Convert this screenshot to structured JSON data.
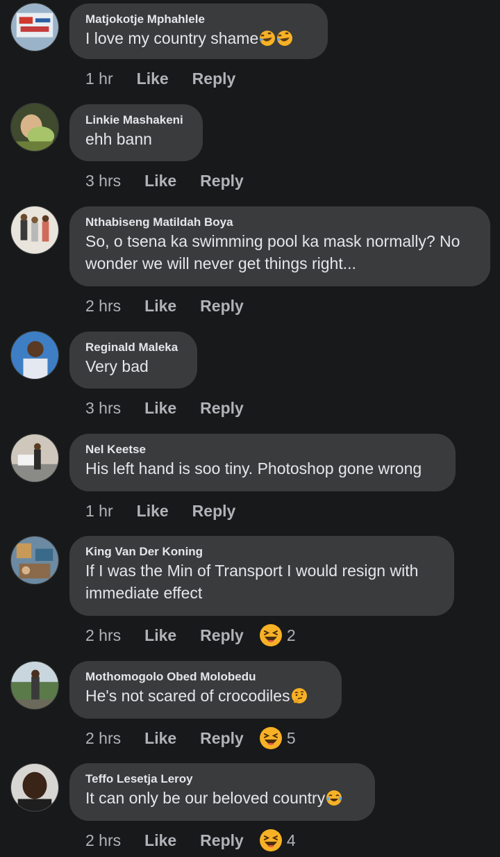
{
  "comments": [
    {
      "author": "Matjokotje Mphahlele",
      "text": "I love my country shame",
      "time": "1 hr",
      "like": "Like",
      "reply": "Reply",
      "inline_emojis": [
        "rolling-laughing-emoji",
        "rolling-laughing-emoji"
      ]
    },
    {
      "author": "Linkie Mashakeni",
      "text": "ehh bann",
      "time": "3 hrs",
      "like": "Like",
      "reply": "Reply"
    },
    {
      "author": "Nthabiseng Matildah Boya",
      "text": "So, o tsena ka swimming pool ka mask normally? No wonder we will never get things right...",
      "time": "2 hrs",
      "like": "Like",
      "reply": "Reply"
    },
    {
      "author": "Reginald Maleka",
      "text": "Very bad",
      "time": "3 hrs",
      "like": "Like",
      "reply": "Reply"
    },
    {
      "author": "Nel Keetse",
      "text": "His left hand is soo tiny. Photoshop gone wrong",
      "time": "1 hr",
      "like": "Like",
      "reply": "Reply"
    },
    {
      "author": "King Van Der Koning",
      "text": "If I was the Min of Transport I would resign with immediate effect",
      "time": "2 hrs",
      "like": "Like",
      "reply": "Reply",
      "reaction": {
        "icon": "haha-reaction-icon",
        "count": "2"
      }
    },
    {
      "author": "Mothomogolo Obed Molobedu",
      "text": "He's not scared of crocodiles",
      "time": "2 hrs",
      "like": "Like",
      "reply": "Reply",
      "inline_emojis": [
        "thinking-emoji"
      ],
      "reaction": {
        "icon": "haha-reaction-icon",
        "count": "5"
      }
    },
    {
      "author": "Teffo Lesetja Leroy",
      "text": "It can only be our beloved country",
      "time": "2 hrs",
      "like": "Like",
      "reply": "Reply",
      "inline_emojis": [
        "tears-of-joy-emoji"
      ],
      "reaction": {
        "icon": "haha-reaction-icon",
        "count": "4"
      }
    }
  ],
  "colors": {
    "background": "#18191a",
    "bubble": "#3a3b3c",
    "primary_text": "#e4e6eb",
    "secondary_text": "#b0b3b8",
    "reaction_yellow": "#f7b125"
  }
}
